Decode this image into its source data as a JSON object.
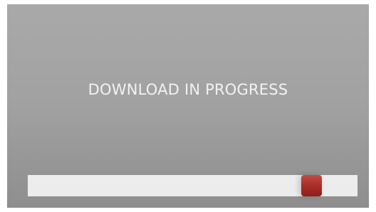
{
  "screen": {
    "title": "DOWNLOAD IN PROGRESS"
  },
  "progress": {
    "value": 0.86,
    "track_color": "#ececec",
    "handle_color": "#a82b27"
  }
}
